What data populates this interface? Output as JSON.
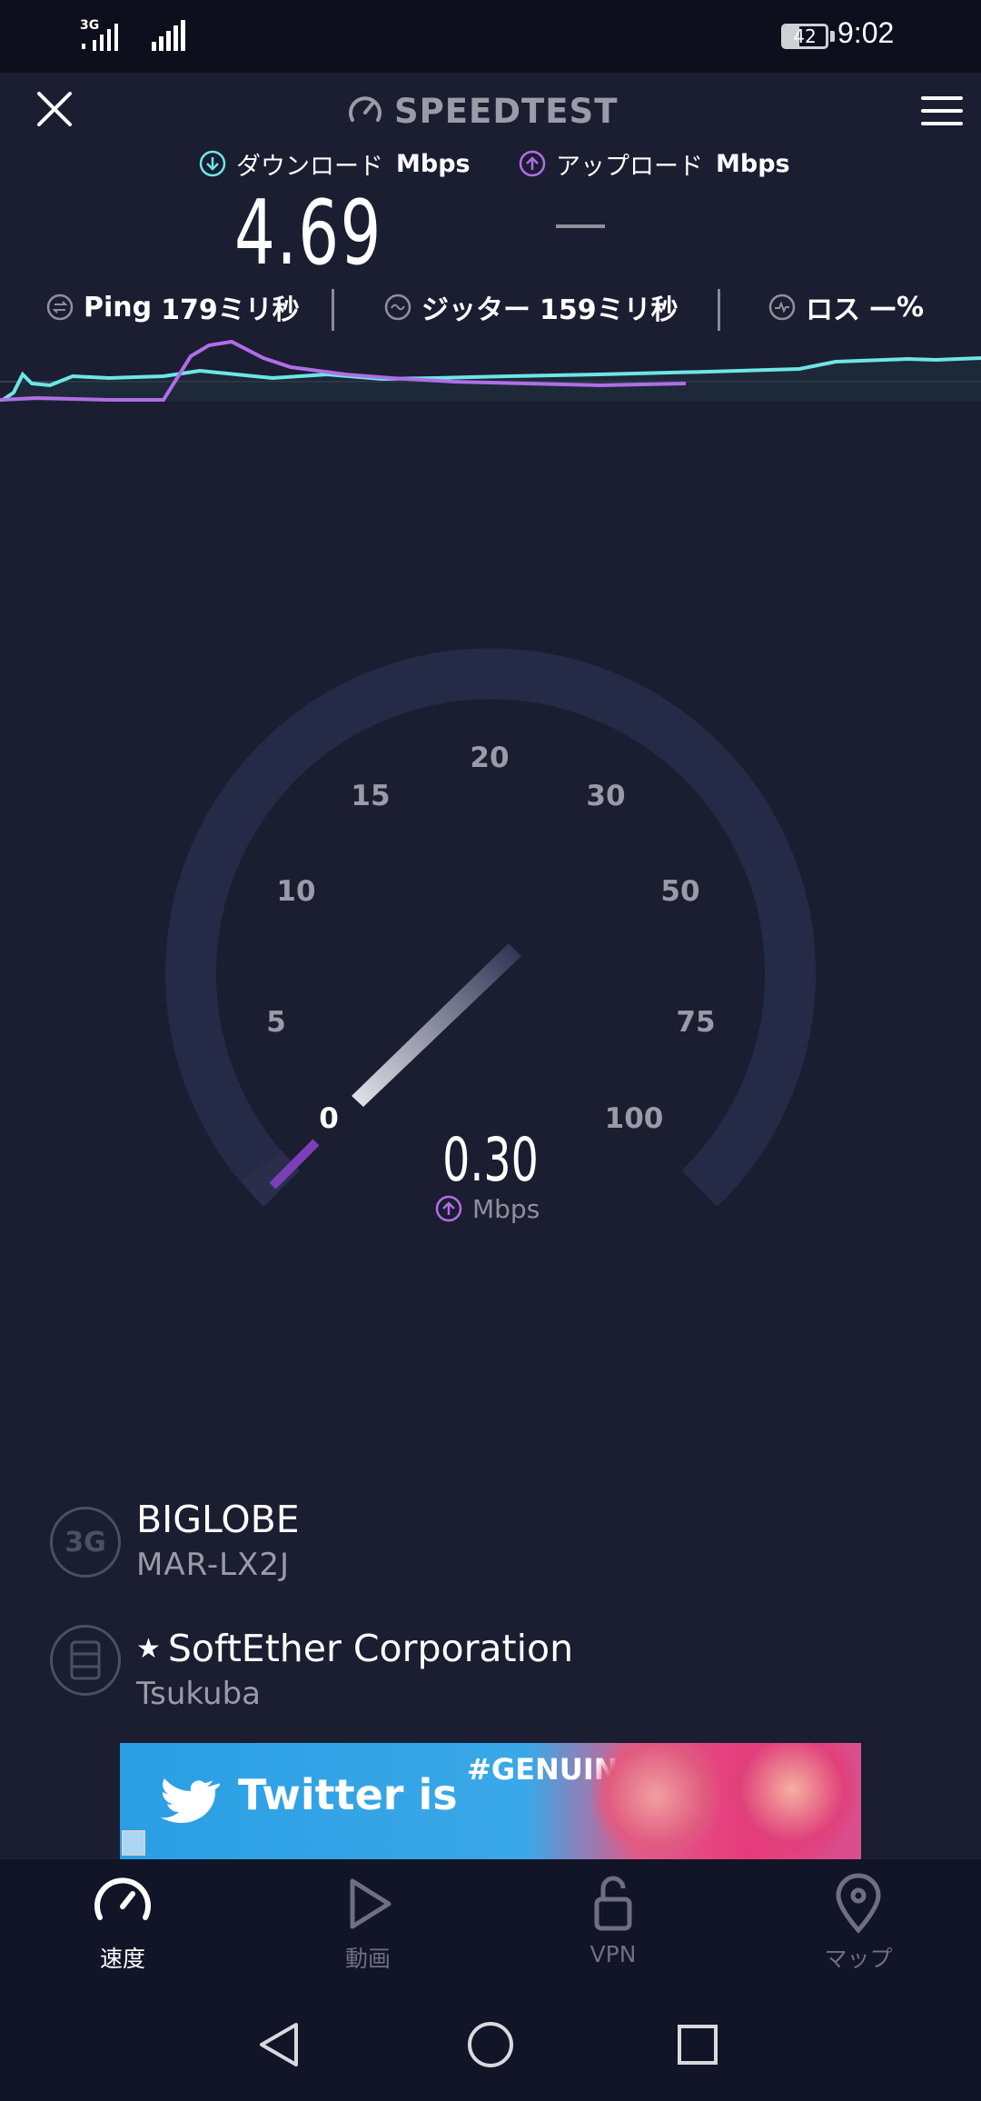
{
  "status_bar": {
    "network_left": "3G",
    "clock": "9:02",
    "battery_level": "42"
  },
  "header": {
    "brand": "SPEEDTEST"
  },
  "speeds": {
    "download_label": "ダウンロード",
    "upload_label": "アップロード",
    "unit": "Mbps",
    "download_value": "4.69",
    "upload_value": "—"
  },
  "stats": {
    "ping_label": "Ping",
    "ping_value": "179ミリ秒",
    "jitter_label": "ジッター",
    "jitter_value": "159ミリ秒",
    "loss_label": "ロス",
    "loss_value": "—%"
  },
  "gauge": {
    "ticks": [
      "0",
      "5",
      "10",
      "15",
      "20",
      "30",
      "50",
      "75",
      "100"
    ],
    "value": "0.30",
    "unit": "Mbps"
  },
  "provider": {
    "network_type": "3G",
    "name": "BIGLOBE",
    "device": "MAR-LX2J"
  },
  "server": {
    "name": "SoftEther Corporation",
    "city": "Tsukuba",
    "star": "★"
  },
  "ad": {
    "text": "Twitter is",
    "hashtag": "#GENUINE"
  },
  "nav": {
    "items": [
      {
        "label": "速度",
        "icon": "speed-gauge-icon",
        "active": true
      },
      {
        "label": "動画",
        "icon": "play-icon",
        "active": false
      },
      {
        "label": "VPN",
        "icon": "unlock-icon",
        "active": false
      },
      {
        "label": "マップ",
        "icon": "map-pin-icon",
        "active": false
      }
    ]
  },
  "colors": {
    "background": "#1b1d31",
    "download_accent": "#6de6e6",
    "upload_accent": "#b06ee6",
    "gauge_track": "#252a46"
  }
}
